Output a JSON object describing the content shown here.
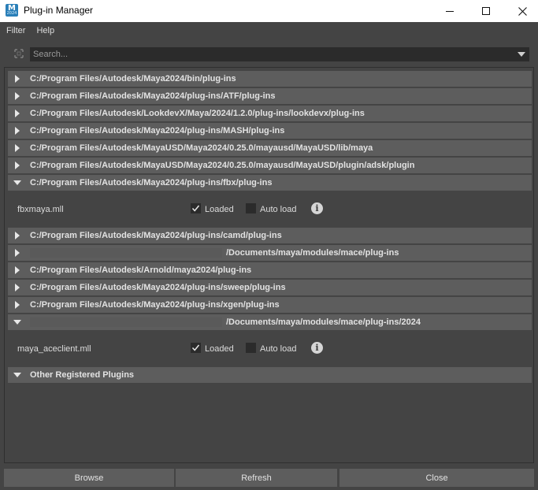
{
  "window": {
    "title": "Plug-in Manager",
    "app_icon_letter": "M",
    "app_icon_sub": "2024"
  },
  "menu": {
    "items": [
      {
        "label": "Filter"
      },
      {
        "label": "Help"
      }
    ]
  },
  "search": {
    "placeholder": "Search...",
    "value": ""
  },
  "folders": [
    {
      "path": "C:/Program Files/Autodesk/Maya2024/bin/plug-ins",
      "expanded": false
    },
    {
      "path": "C:/Program Files/Autodesk/Maya2024/plug-ins/ATF/plug-ins",
      "expanded": false
    },
    {
      "path": "C:/Program Files/Autodesk/LookdevX/Maya/2024/1.2.0/plug-ins/lookdevx/plug-ins",
      "expanded": false
    },
    {
      "path": "C:/Program Files/Autodesk/Maya2024/plug-ins/MASH/plug-ins",
      "expanded": false
    },
    {
      "path": "C:/Program Files/Autodesk/MayaUSD/Maya2024/0.25.0/mayausd/MayaUSD/lib/maya",
      "expanded": false
    },
    {
      "path": "C:/Program Files/Autodesk/MayaUSD/Maya2024/0.25.0/mayausd/MayaUSD/plugin/adsk/plugin",
      "expanded": false
    },
    {
      "path": "C:/Program Files/Autodesk/Maya2024/plug-ins/fbx/plug-ins",
      "expanded": true,
      "plugins": [
        {
          "name": "fbxmaya.mll",
          "loaded": true,
          "auto_load": false
        }
      ]
    },
    {
      "path": "C:/Program Files/Autodesk/Maya2024/plug-ins/camd/plug-ins",
      "expanded": false
    },
    {
      "path": "/Documents/maya/modules/mace/plug-ins",
      "expanded": false,
      "redacted_prefix": true
    },
    {
      "path": "C:/Program Files/Autodesk/Arnold/maya2024/plug-ins",
      "expanded": false
    },
    {
      "path": "C:/Program Files/Autodesk/Maya2024/plug-ins/sweep/plug-ins",
      "expanded": false
    },
    {
      "path": "C:/Program Files/Autodesk/Maya2024/plug-ins/xgen/plug-ins",
      "expanded": false
    },
    {
      "path": "/Documents/maya/modules/mace/plug-ins/2024",
      "expanded": true,
      "redacted_prefix": true,
      "plugins": [
        {
          "name": "maya_aceclient.mll",
          "loaded": true,
          "auto_load": false
        }
      ]
    },
    {
      "path": "Other Registered Plugins",
      "expanded": true
    }
  ],
  "labels": {
    "loaded": "Loaded",
    "auto_load": "Auto load",
    "info_glyph": "i"
  },
  "buttons": {
    "browse": "Browse",
    "refresh": "Refresh",
    "close": "Close"
  }
}
